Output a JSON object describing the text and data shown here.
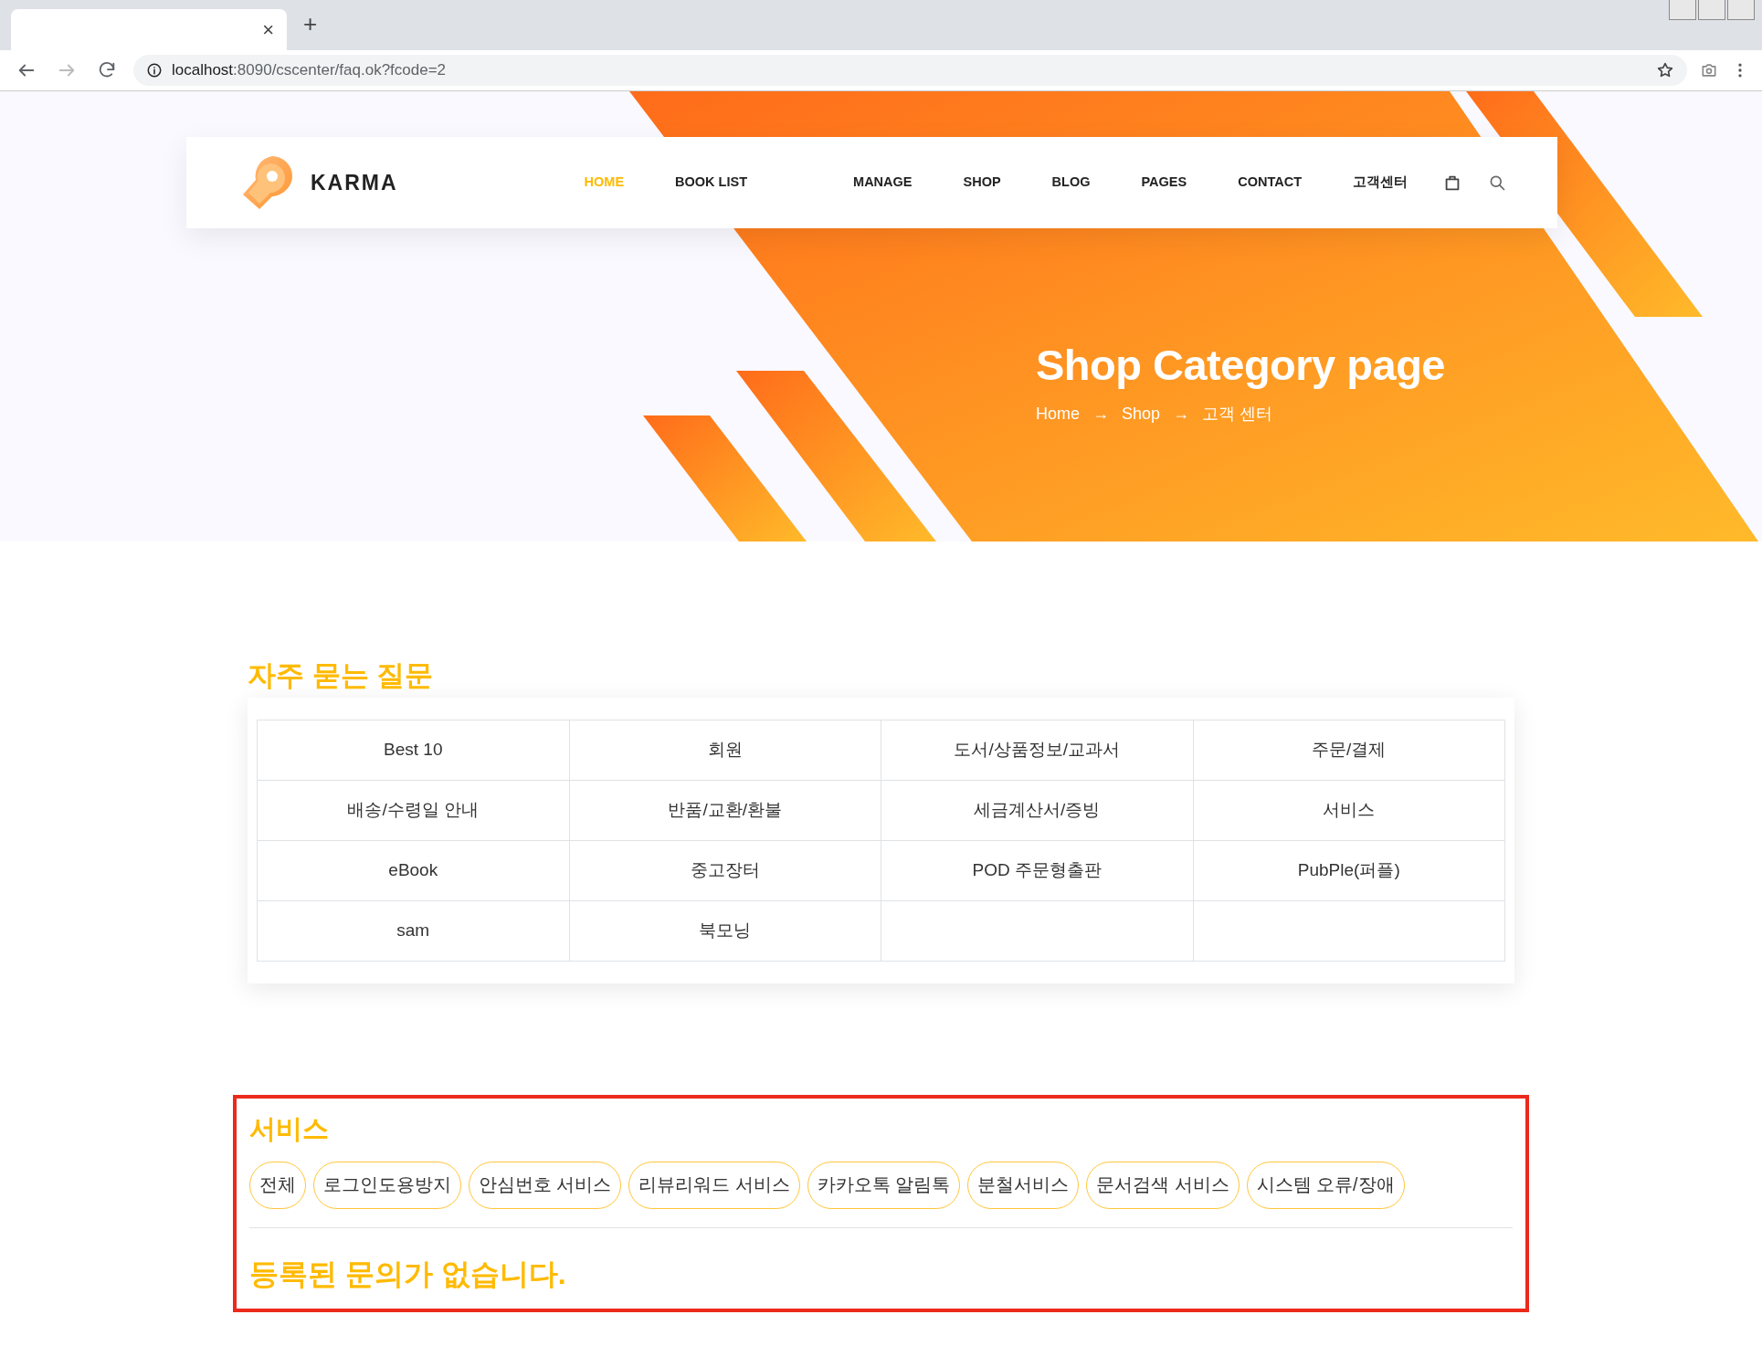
{
  "browser": {
    "tab": {
      "close": "×"
    },
    "new_tab": "+",
    "nav_buttons": [
      {
        "kind": "back",
        "disabled": false
      },
      {
        "kind": "forward",
        "disabled": true
      },
      {
        "kind": "reload",
        "disabled": false
      }
    ],
    "url_host": "localhost",
    "url_path": ":8090/cscenter/faq.ok?fcode=2"
  },
  "navbar": {
    "brand": "KARMA",
    "items": [
      {
        "label": "HOME",
        "selected": true
      },
      {
        "label": "BOOK LIST",
        "selected": false
      },
      {
        "label": "MANAGE",
        "selected": false
      },
      {
        "label": "SHOP",
        "selected": false
      },
      {
        "label": "BLOG",
        "selected": false
      },
      {
        "label": "PAGES",
        "selected": false
      },
      {
        "label": "CONTACT",
        "selected": false
      },
      {
        "label": "고객센터",
        "selected": false
      }
    ]
  },
  "hero": {
    "title": "Shop Category page",
    "separator": "→",
    "breadcrumb": [
      "Home",
      "Shop",
      "고객 센터"
    ]
  },
  "faq": {
    "heading": "자주 묻는 질문",
    "categories": [
      [
        "Best 10",
        "회원",
        "도서/상품정보/교과서",
        "주문/결제"
      ],
      [
        "배송/수령일 안내",
        "반품/교환/환불",
        "세금계산서/증빙",
        "서비스"
      ],
      [
        "eBook",
        "중고장터",
        "POD 주문형출판",
        "PubPle(퍼플)"
      ],
      [
        "sam",
        "북모닝"
      ]
    ]
  },
  "service": {
    "highlighted": true,
    "heading": "서비스",
    "filters": [
      "전체",
      "로그인도용방지",
      "안심번호 서비스",
      "리뷰리워드 서비스",
      "카카오톡 알림톡",
      "분철서비스",
      "문서검색 서비스",
      "시스템 오류/장애"
    ],
    "message": "등록된 문의가 없습니다."
  }
}
